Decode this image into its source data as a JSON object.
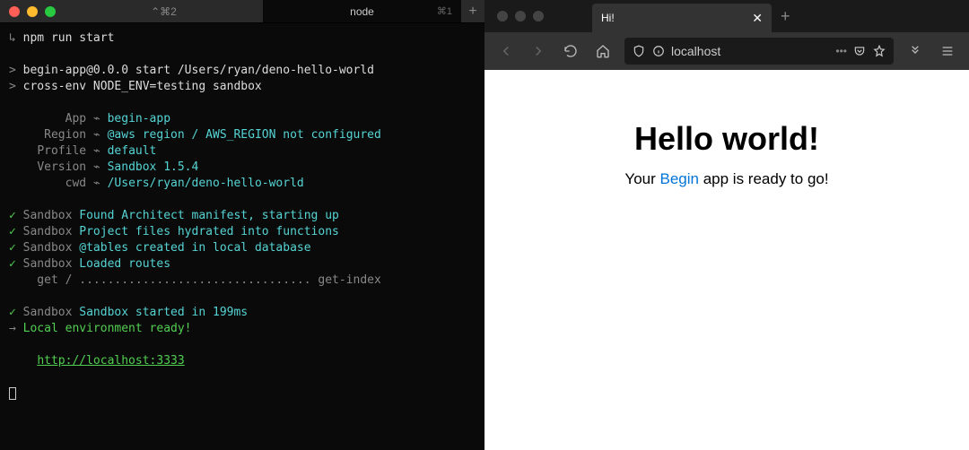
{
  "terminal": {
    "tabs": [
      {
        "label": "⌃⌘2",
        "shortcut": ""
      },
      {
        "label": "node",
        "shortcut": "⌘1"
      }
    ],
    "prompt_arrow": "↳ ",
    "command": "npm run start",
    "out1_prefix": "> ",
    "out1": "begin-app@0.0.0 start /Users/ryan/deno-hello-world",
    "out2_prefix": "> ",
    "out2": "cross-env NODE_ENV=testing sandbox",
    "kv": [
      {
        "label": "App",
        "sep": " ⌁ ",
        "value": "begin-app"
      },
      {
        "label": "Region",
        "sep": " ⌁ ",
        "value": "@aws region / AWS_REGION not configured"
      },
      {
        "label": "Profile",
        "sep": " ⌁ ",
        "value": "default"
      },
      {
        "label": "Version",
        "sep": " ⌁ ",
        "value": "Sandbox 1.5.4"
      },
      {
        "label": "cwd",
        "sep": " ⌁ ",
        "value": "/Users/ryan/deno-hello-world"
      }
    ],
    "checks": [
      {
        "mark": "✓",
        "src": "Sandbox",
        "msg": "Found Architect manifest, starting up"
      },
      {
        "mark": "✓",
        "src": "Sandbox",
        "msg": "Project files hydrated into functions"
      },
      {
        "mark": "✓",
        "src": "Sandbox",
        "msg": "@tables created in local database"
      },
      {
        "mark": "✓",
        "src": "Sandbox",
        "msg": "Loaded routes"
      }
    ],
    "routes_line": "    get / ................................. get-index",
    "checks2": [
      {
        "mark": "✓",
        "src": "Sandbox",
        "msg": "Sandbox started in 199ms"
      }
    ],
    "env_ready_prefix": "→ ",
    "env_ready": "Local environment ready!",
    "url": "http://localhost:3333"
  },
  "browser": {
    "tab_title": "Hi!",
    "url": "localhost",
    "toolbar_dots": "•••",
    "page": {
      "heading": "Hello world!",
      "sub_before": "Your ",
      "sub_link": "Begin",
      "sub_after": " app is ready to go!"
    }
  }
}
